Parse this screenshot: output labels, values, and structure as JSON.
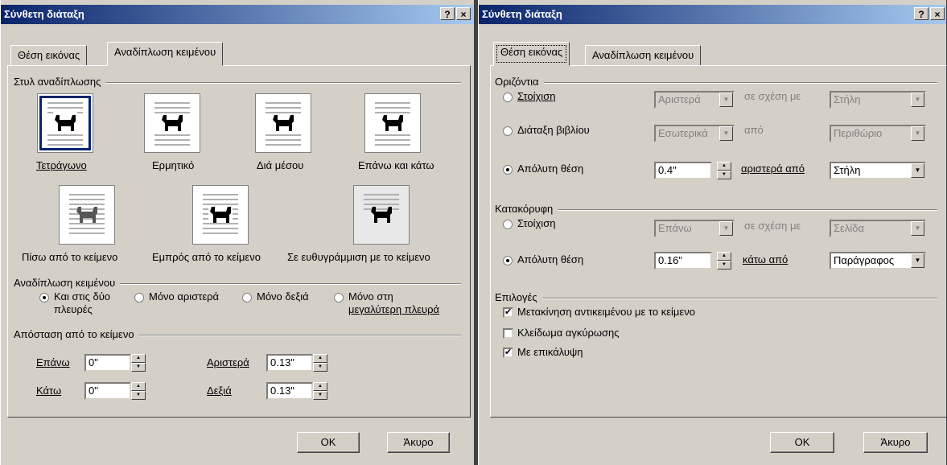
{
  "left_dialog": {
    "title": "Σύνθετη διάταξη",
    "help_btn": "?",
    "close_btn": "×",
    "tabs": [
      "Θέση εικόνας",
      "Αναδίπλωση κειμένου"
    ],
    "wrap_style": {
      "title": "Στυλ αναδίπλωσης",
      "options": [
        "Τετράγωνο",
        "Ερμητικό",
        "Διά μέσου",
        "Επάνω και κάτω",
        "Πίσω από το κείμενο",
        "Εμπρός από το κείμενο",
        "Σε ευθυγράμμιση με το κείμενο"
      ],
      "selected": "Τετράγωνο"
    },
    "wrap_text": {
      "title": "Αναδίπλωση κειμένου",
      "opt1_line1": "Και στις δύο",
      "opt1_line2": "πλευρές",
      "opt2": "Μόνο αριστερά",
      "opt3": "Μόνο δεξιά",
      "opt4_line1": "Μόνο στη",
      "opt4_line2": "μεγαλύτερη πλευρά",
      "selected": "Και στις δύο πλευρές"
    },
    "distance": {
      "title": "Απόσταση από το κείμενο",
      "top_label": "Επάνω",
      "top_value": "0\"",
      "bottom_label": "Κάτω",
      "bottom_value": "0\"",
      "left_label": "Αριστερά",
      "left_value": "0.13\"",
      "right_label": "Δεξιά",
      "right_value": "0.13\""
    },
    "ok": "OK",
    "cancel": "Άκυρο"
  },
  "right_dialog": {
    "title": "Σύνθετη διάταξη",
    "help_btn": "?",
    "close_btn": "×",
    "tabs": [
      "Θέση εικόνας",
      "Αναδίπλωση κειμένου"
    ],
    "horizontal": {
      "title": "Οριζόντια",
      "alignment_label": "Στοίχιση",
      "alignment_value": "Αριστερά",
      "relative_label": "σε σχέση με",
      "relative_value": "Στήλη",
      "book_label": "Διάταξη βιβλίου",
      "book_value": "Εσωτερικά",
      "of_label": "από",
      "of_value": "Περιθώριο",
      "absolute_label": "Απόλυτη θέση",
      "absolute_value": "0.4\"",
      "left_of_label": "αριστερά από",
      "left_of_value": "Στήλη",
      "selected": "Απόλυτη θέση"
    },
    "vertical": {
      "title": "Κατακόρυφη",
      "alignment_label": "Στοίχιση",
      "alignment_value": "Επάνω",
      "relative_label": "σε σχέση με",
      "relative_value": "Σελίδα",
      "absolute_label": "Απόλυτη θέση",
      "absolute_value": "0.16\"",
      "below_label": "κάτω από",
      "below_value": "Παράγραφος",
      "selected": "Απόλυτη θέση"
    },
    "options": {
      "title": "Επιλογές",
      "move_with_text": "Μετακίνηση αντικειμένου με το κείμενο",
      "lock_anchor": "Κλείδωμα αγκύρωσης",
      "allow_overlap": "Με επικάλυψη",
      "checked": [
        "Μετακίνηση αντικειμένου με το κείμενο",
        "Με επικάλυψη"
      ]
    },
    "ok": "OK",
    "cancel": "Άκυρο"
  }
}
